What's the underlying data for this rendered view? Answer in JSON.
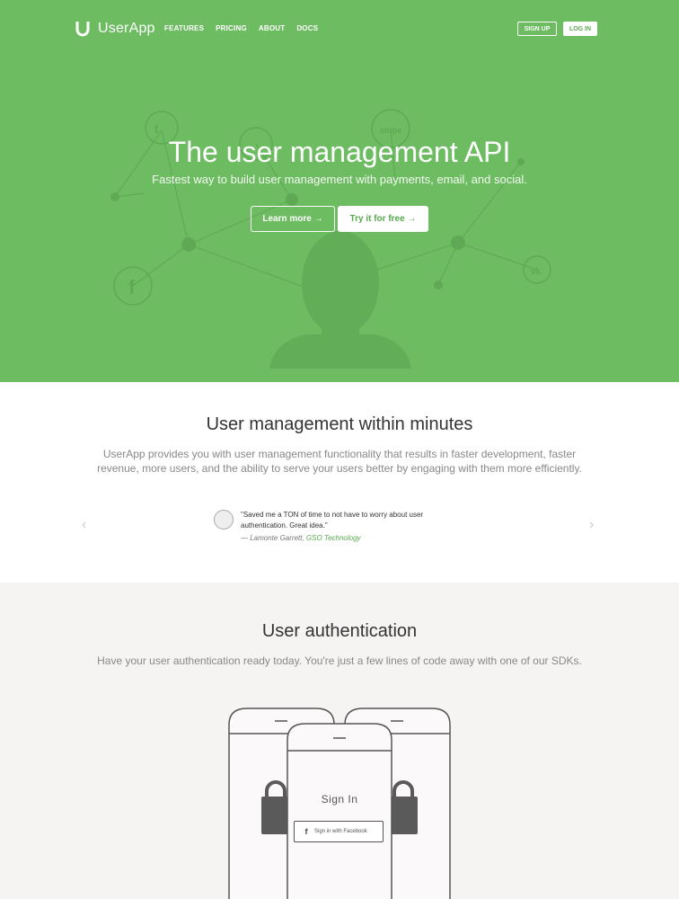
{
  "nav": {
    "logo_text": "UserApp",
    "links": [
      "FEATURES",
      "PRICING",
      "ABOUT",
      "DOCS"
    ],
    "signup_label": "SIGN UP",
    "login_label": "LOG IN"
  },
  "hero": {
    "title": "The user management API",
    "subtitle": "Fastest way to build user management with payments, email, and social.",
    "learn_more_label": "Learn more →",
    "try_free_label": "Try it for free →",
    "brand_color": "#6dbc62"
  },
  "features": {
    "title": "User management within minutes",
    "description": "UserApp provides you with user management functionality that results in faster development, faster revenue, more users, and the ability to serve your users better by engaging with them more efficiently.",
    "testimonial": {
      "quote": "\"Saved me a TON of time to not have to worry about user authentication. Great idea.\"",
      "author": "— Lamonte Garrett, ",
      "company": "GSO Technology"
    }
  },
  "auth": {
    "title": "User authentication",
    "description": "Have your user authentication ready today. You're just a few lines of code away with one of our SDKs.",
    "signin_label": "Sign In",
    "facebook_label": "Sign in with Facebook"
  }
}
